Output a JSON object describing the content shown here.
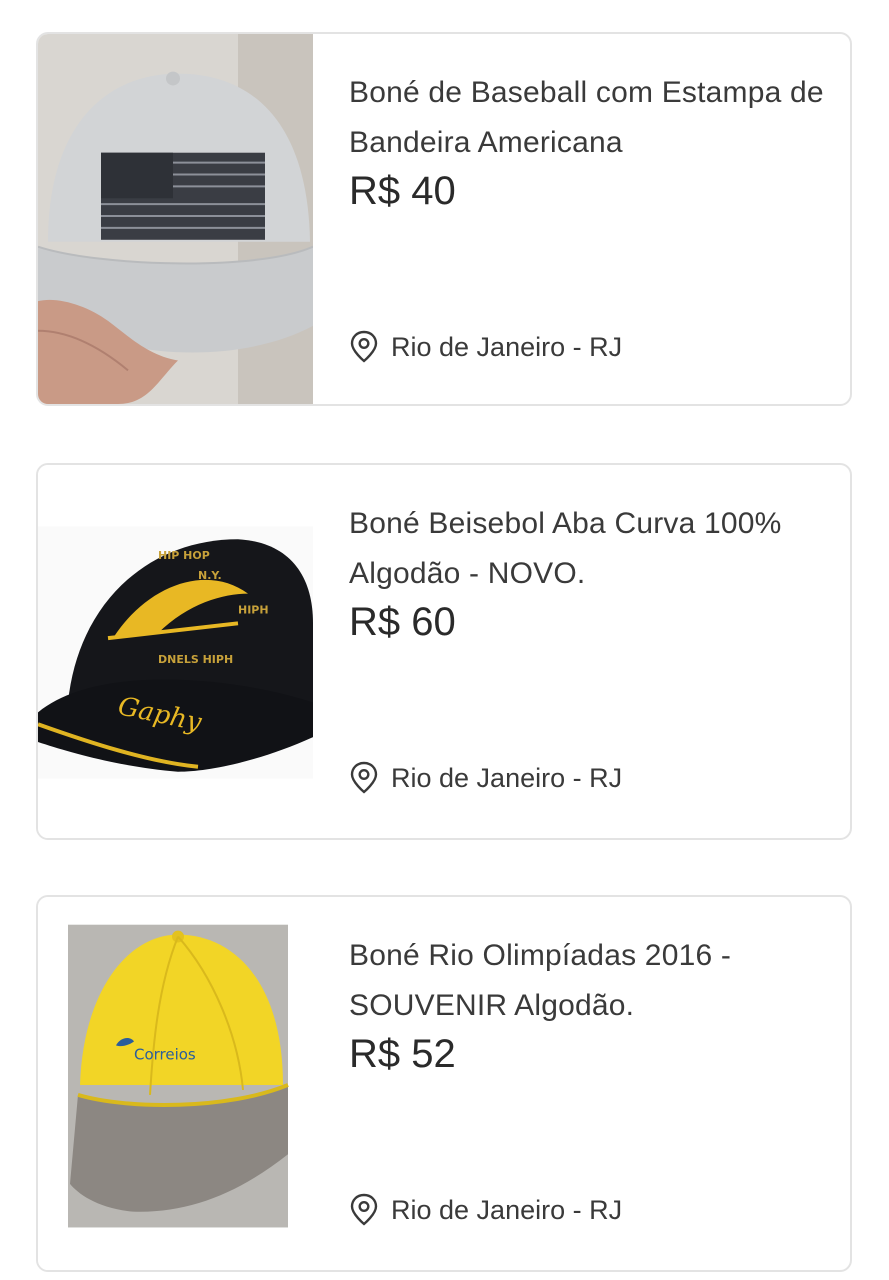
{
  "listings": [
    {
      "title": "Boné de Baseball com Estampa de Bandeira Americana",
      "price": "R$ 40",
      "location": "Rio de Janeiro - RJ",
      "image": "gray-cap-american-flag"
    },
    {
      "title": "Boné Beisebol Aba Curva 100% Algodão - NOVO.",
      "price": "R$ 60",
      "location": "Rio de Janeiro - RJ",
      "image": "black-yellow-cap-gaphy",
      "cap_text": "Gaphy"
    },
    {
      "title": "Boné Rio Olimpíadas 2016 - SOUVENIR Algodão.",
      "price": "R$ 52",
      "location": "Rio de Janeiro - RJ",
      "image": "yellow-correios-cap",
      "cap_text": "Correios"
    }
  ],
  "icons": {
    "location": "location-pin-icon"
  },
  "colors": {
    "card_border": "#e3e3e3",
    "text": "#3a3a3a",
    "price": "#2a2a2a"
  }
}
